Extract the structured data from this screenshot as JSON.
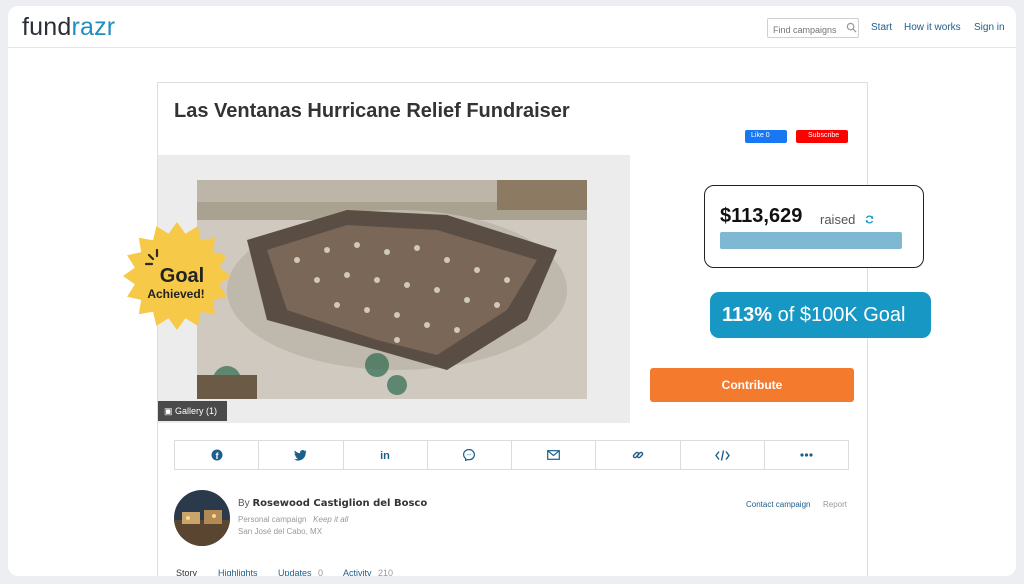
{
  "brand": {
    "part1": "fund",
    "part2": "razr"
  },
  "header": {
    "search_placeholder": "Find campaigns",
    "nav": {
      "start": "Start",
      "how": "How it works",
      "signin": "Sign in"
    }
  },
  "campaign": {
    "title": "Las Ventanas Hurricane Relief Fundraiser",
    "like_label": "Like 0",
    "subscribe_label": "Subscribe",
    "gallery_label": "Gallery (1)",
    "contribute_label": "Contribute",
    "raised_amount": "$113,629",
    "raised_label": "raised",
    "progress_fraction": 1.0,
    "goal_percent": "113%",
    "goal_text": "of $100K Goal",
    "badge_line1": "Goal",
    "badge_line2": "Achieved!"
  },
  "share_icons": [
    "facebook-icon",
    "twitter-icon",
    "linkedin-icon",
    "messenger-icon",
    "email-icon",
    "link-icon",
    "embed-icon",
    "more-icon"
  ],
  "owner": {
    "by": "By",
    "name": "Rosewood Castiglion del Bosco",
    "type": "Personal campaign",
    "keep": "Keep it all",
    "location": "San José del Cabo, MX",
    "contact_label": "Contact campaign",
    "report_label": "Report"
  },
  "tabs": {
    "story": "Story",
    "highlights": "Highlights",
    "updates": "Updates",
    "updates_count": "0",
    "activity": "Activity",
    "activity_count": "210"
  },
  "colors": {
    "accent": "#1797c4",
    "contribute": "#f47a2d",
    "badge": "#f7c948"
  }
}
